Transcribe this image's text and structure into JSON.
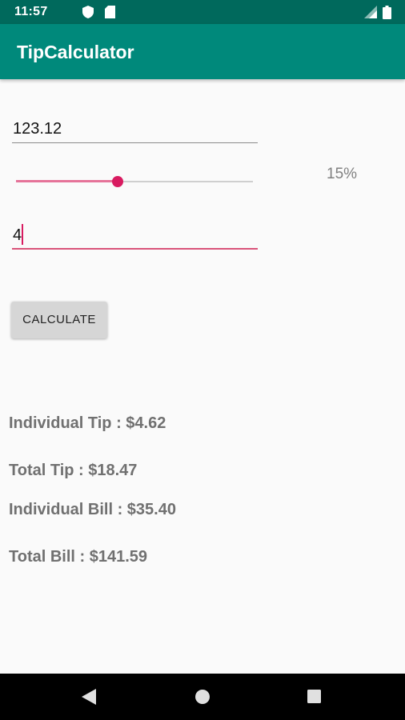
{
  "status_bar": {
    "time": "11:57",
    "left_icons": [
      "shield-icon",
      "sd-card-icon"
    ],
    "right_icons": [
      "signal-icon",
      "battery-icon"
    ]
  },
  "app_bar": {
    "title": "TipCalculator"
  },
  "form": {
    "bill_amount": "123.12",
    "tip_percent_value": 0.43,
    "tip_percent_label": "15%",
    "people_count": "4",
    "calculate_label": "CALCULATE"
  },
  "results": {
    "individual_tip": "Individual Tip : $4.62",
    "total_tip": "Total Tip : $18.47",
    "individual_bill": "Individual Bill : $35.40",
    "total_bill": "Total Bill : $141.59"
  },
  "colors": {
    "status_bar": "#00695c",
    "app_bar": "#00897b",
    "accent": "#d81b60",
    "background": "#fafafa"
  },
  "nav_bar": {
    "icons": [
      "back-icon",
      "home-icon",
      "recents-icon"
    ]
  }
}
